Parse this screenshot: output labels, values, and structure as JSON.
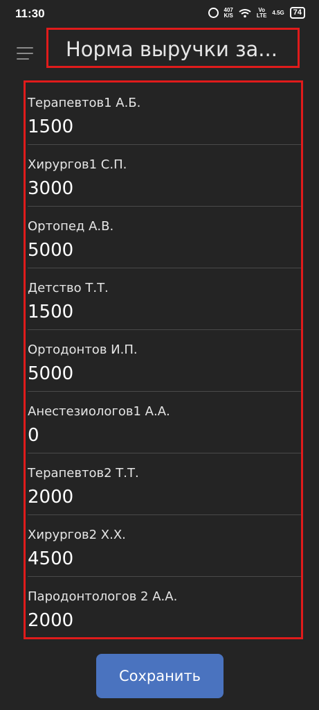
{
  "status_bar": {
    "time": "11:30",
    "net_speed_value": "407",
    "net_speed_unit": "K/S",
    "volte_top": "Vo",
    "volte_bottom": "LTE",
    "signal_label": "4.5G",
    "battery": "74"
  },
  "header": {
    "title": "Норма выручки за..."
  },
  "items": [
    {
      "name": "Терапевтов1 А.Б.",
      "value": "1500"
    },
    {
      "name": "Хирургов1 С.П.",
      "value": "3000"
    },
    {
      "name": "Ортопед А.В.",
      "value": "5000"
    },
    {
      "name": "Детство Т.Т.",
      "value": "1500"
    },
    {
      "name": "Ортодонтов И.П.",
      "value": "5000"
    },
    {
      "name": "Анестезиологов1 А.А.",
      "value": "0"
    },
    {
      "name": "Терапевтов2 Т.Т.",
      "value": "2000"
    },
    {
      "name": "Хирургов2 Х.Х.",
      "value": "4500"
    },
    {
      "name": "Пародонтологов 2 А.А.",
      "value": "2000"
    }
  ],
  "save_button": {
    "label": "Сохранить"
  },
  "colors": {
    "background": "#242424",
    "highlight_border": "#e01b1b",
    "button": "#4a73bf"
  }
}
